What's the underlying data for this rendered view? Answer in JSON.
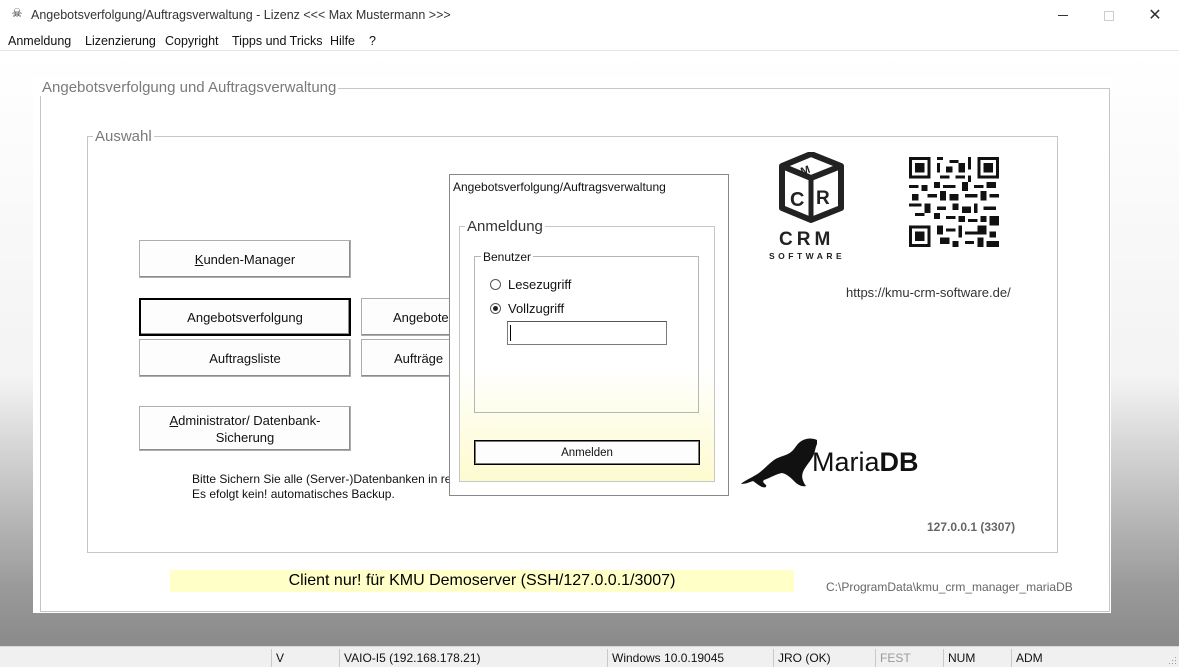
{
  "window": {
    "title": "Angebotsverfolgung/Auftragsverwaltung - Lizenz <<< Max Mustermann >>>",
    "icon": "skull-icon"
  },
  "menu": [
    "Anmeldung",
    "Lizenzierung",
    "Copyright",
    "Tipps und Tricks",
    "Hilfe",
    "?"
  ],
  "main": {
    "outer_group_title": "Angebotsverfolgung und Auftragsverwaltung",
    "auswahl_title": "Auswahl",
    "buttons": {
      "kunden_manager": "Kunden-Manager",
      "angebotsverfolgung": "Angebotsverfolgung",
      "angebote_cut": "Angebote",
      "auftragsliste": "Auftragsliste",
      "auftraege_cut": "Aufträge",
      "administrator": "Administrator/ Datenbank-Sicherung"
    },
    "note_line1": "Bitte Sichern Sie alle (Server-)Datenbanken in reg",
    "note_line2": "Es efolgt kein! automatisches Backup.",
    "crm_text": "CRM",
    "crm_sub": "SOFTWARE",
    "url": "https://kmu-crm-software.de/",
    "mariadb_label_a": "Maria",
    "mariadb_label_b": "DB",
    "server_addr": "127.0.0.1 (3307)",
    "banner": "Client nur! für KMU Demoserver (SSH/127.0.0.1/3007)",
    "data_path": "C:\\ProgramData\\kmu_crm_manager_mariaDB"
  },
  "dialog": {
    "title": "Angebotsverfolgung/Auftragsverwaltung",
    "group_title": "Anmeldung",
    "benutzer_title": "Benutzer",
    "radio_lese": "Lesezugriff",
    "radio_voll": "Vollzugriff",
    "selected": "Vollzugriff",
    "password_value": "",
    "submit": "Anmelden"
  },
  "statusbar": [
    "V",
    "VAIO-I5 (192.168.178.21)",
    "Windows 10.0.19045",
    "JRO (OK)",
    "FEST",
    "NUM",
    "ADM"
  ],
  "colors": {
    "banner": "#ffffc8",
    "dialog_gradient_end": "#fdfbcf"
  }
}
